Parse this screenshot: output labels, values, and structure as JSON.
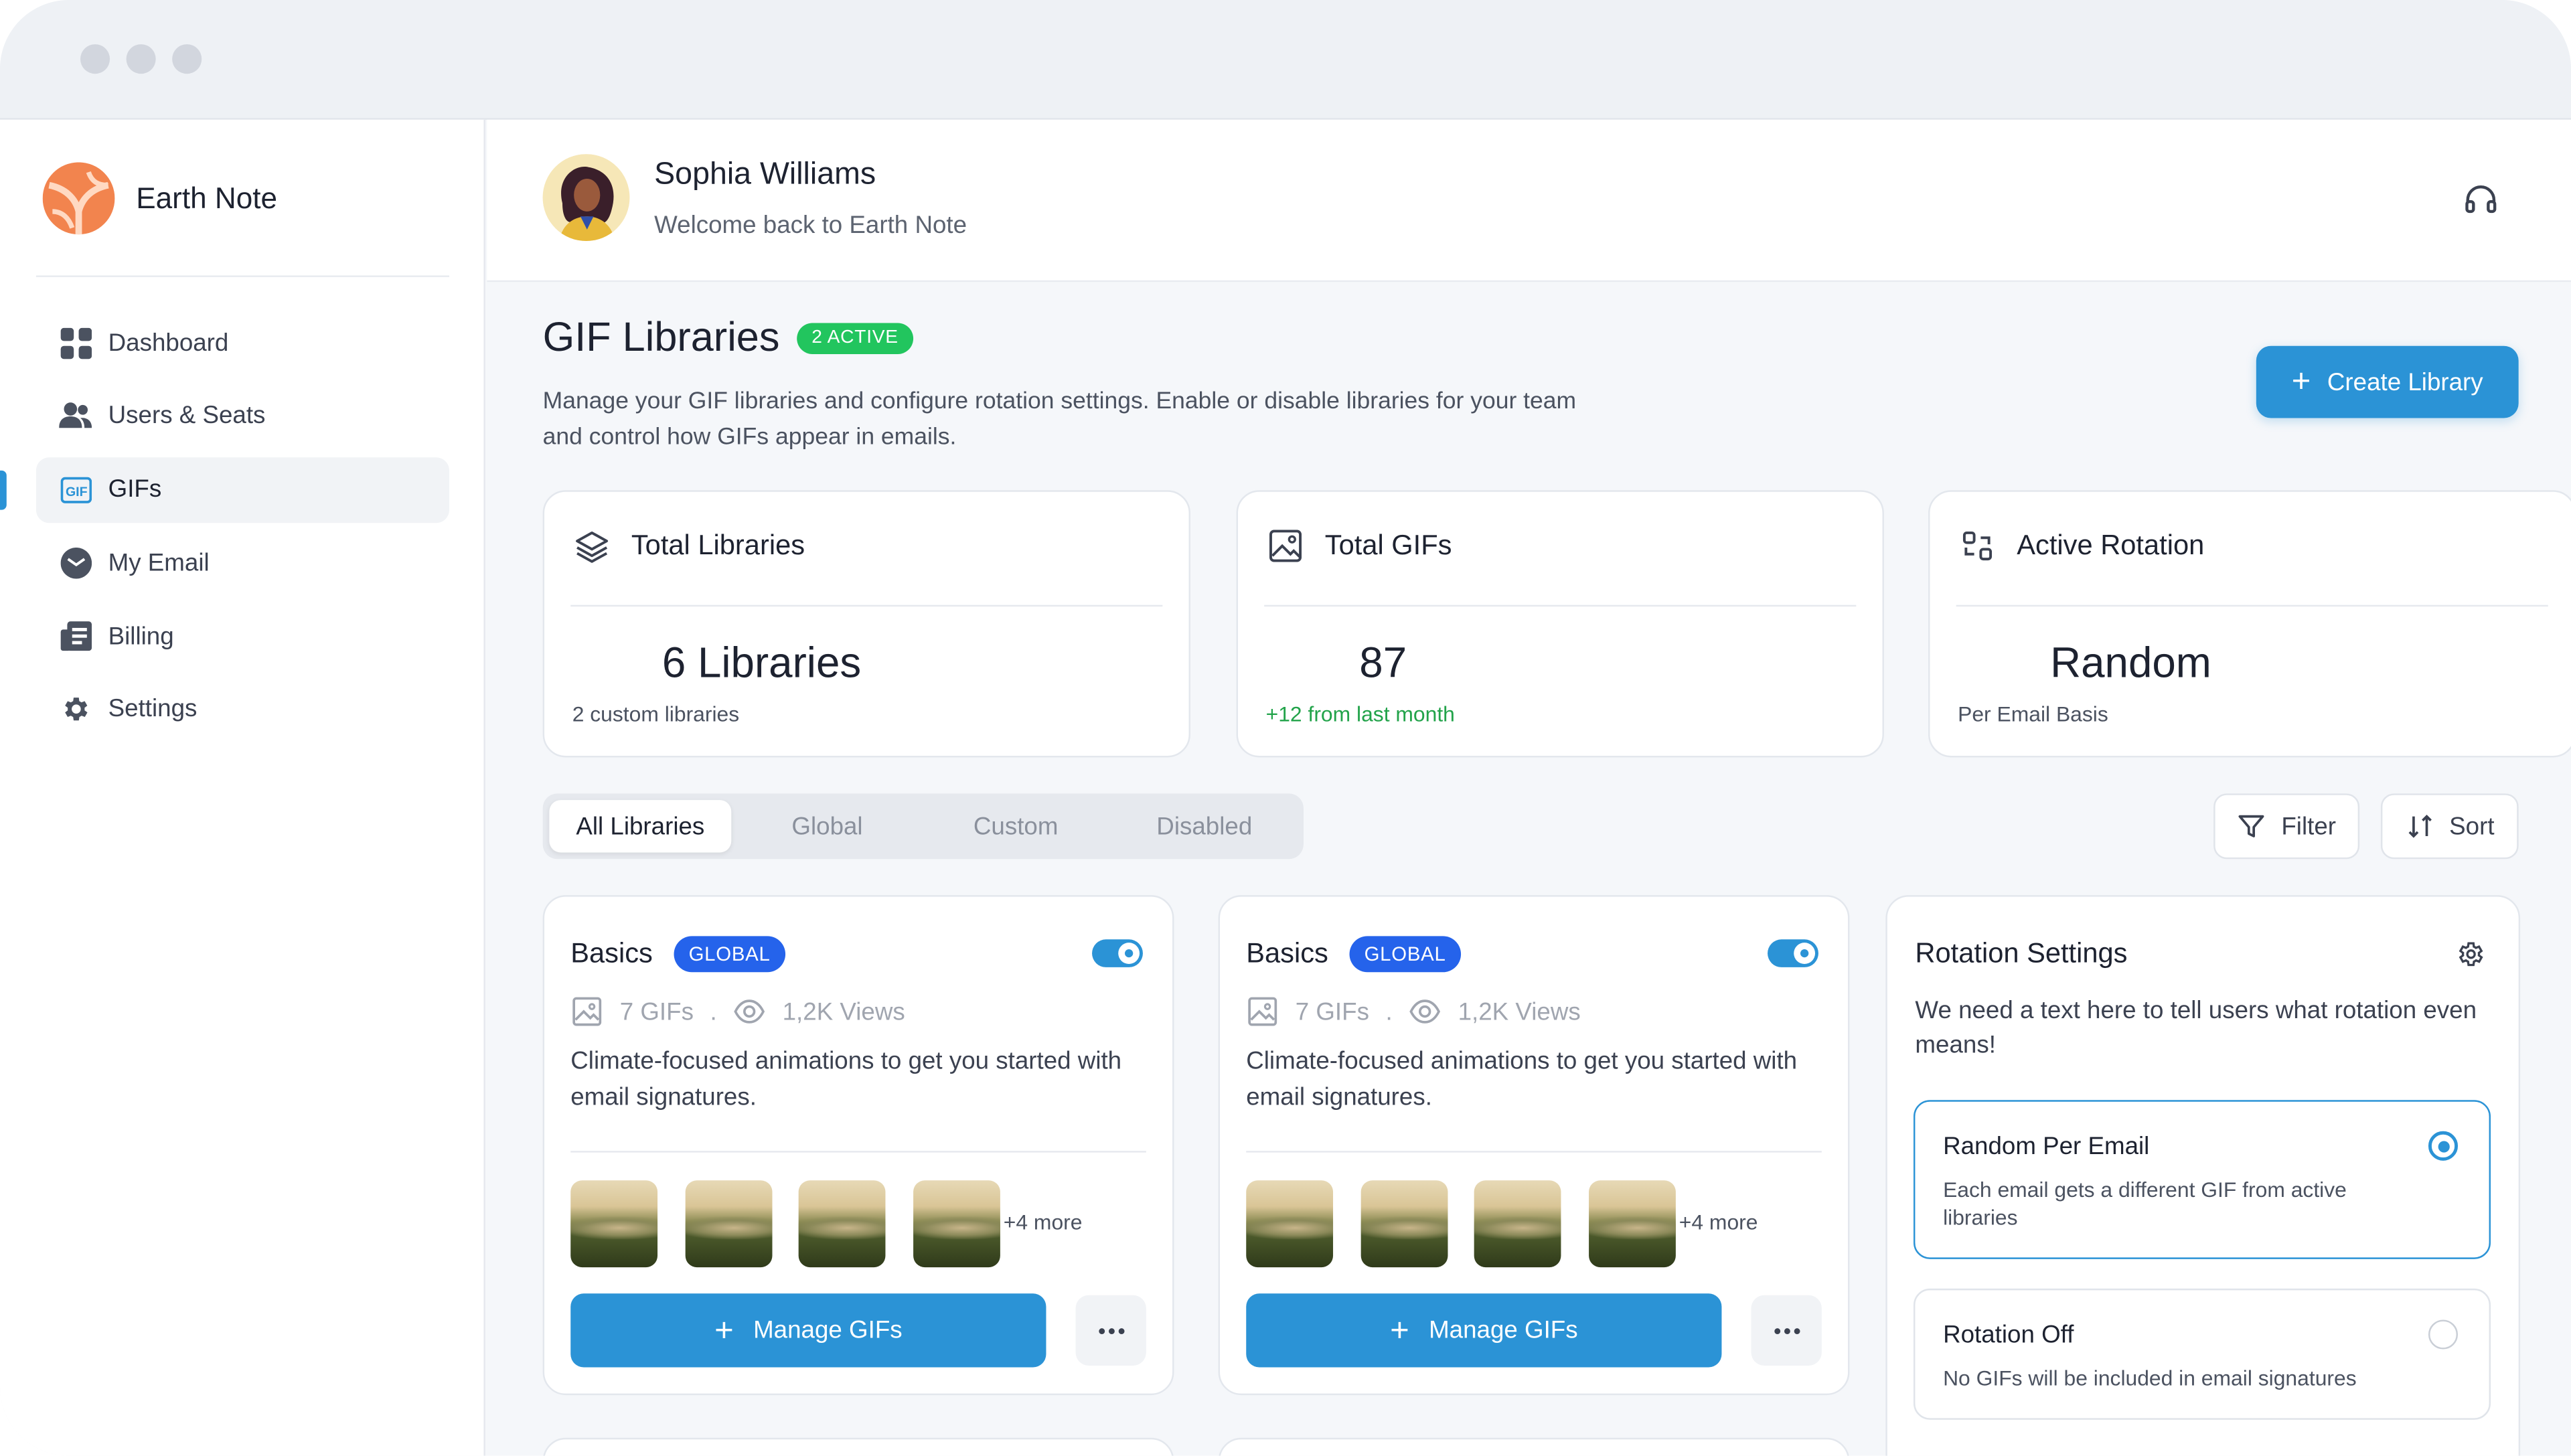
{
  "app": {
    "name": "Earth Note"
  },
  "sidebar": {
    "items": [
      {
        "label": "Dashboard",
        "icon": "grid-icon",
        "active": false
      },
      {
        "label": "Users & Seats",
        "icon": "users-icon",
        "active": false
      },
      {
        "label": "GIFs",
        "icon": "gif-icon",
        "active": true
      },
      {
        "label": "My Email",
        "icon": "mail-icon",
        "active": false
      },
      {
        "label": "Billing",
        "icon": "billing-icon",
        "active": false
      },
      {
        "label": "Settings",
        "icon": "gear-icon",
        "active": false
      }
    ]
  },
  "header": {
    "user_name": "Sophia Williams",
    "welcome": "Welcome back to Earth Note",
    "support_icon": "headphones-icon"
  },
  "page": {
    "title": "GIF Libraries",
    "active_badge": "2 ACTIVE",
    "description": "Manage your GIF libraries and configure rotation settings. Enable or disable libraries for your team and control how GIFs appear in emails.",
    "create_button": "Create Library"
  },
  "stats": [
    {
      "label": "Total Libraries",
      "value": "6 Libraries",
      "sub": "2 custom libraries",
      "icon": "layers-icon"
    },
    {
      "label": "Total GIFs",
      "value": "87",
      "sub": "+12 from last month",
      "icon": "image-icon"
    },
    {
      "label": "Active Rotation",
      "value": "Random",
      "sub": "Per Email Basis",
      "icon": "rotation-icon"
    }
  ],
  "tabs": [
    "All Libraries",
    "Global",
    "Custom",
    "Disabled"
  ],
  "active_tab": "All Libraries",
  "toolbar": {
    "filter": "Filter",
    "sort": "Sort"
  },
  "libraries": [
    {
      "title": "Basics",
      "badge": "GLOBAL",
      "enabled": true,
      "gif_count": "7 GIFs",
      "dot": ".",
      "views": "1,2K Views",
      "description": "Climate-focused animations to get you started with email signatures.",
      "more": "+4 more",
      "manage": "Manage GIFs"
    },
    {
      "title": "Basics",
      "badge": "GLOBAL",
      "enabled": true,
      "gif_count": "7 GIFs",
      "dot": ".",
      "views": "1,2K Views",
      "description": "Climate-focused animations to get you started with email signatures.",
      "more": "+4 more",
      "manage": "Manage GIFs"
    }
  ],
  "rotation": {
    "title": "Rotation Settings",
    "description": "We need a text here to tell users what rotation even means!",
    "options": [
      {
        "title": "Random Per Email",
        "desc": "Each email gets a different GIF from active libraries",
        "selected": true
      },
      {
        "title": "Rotation Off",
        "desc": "No GIFs will be included in email signatures",
        "selected": false
      }
    ]
  },
  "colors": {
    "accent": "#2b93d6",
    "success": "#22c55e",
    "badge_blue": "#2563eb",
    "positive_text": "#22a34a"
  }
}
